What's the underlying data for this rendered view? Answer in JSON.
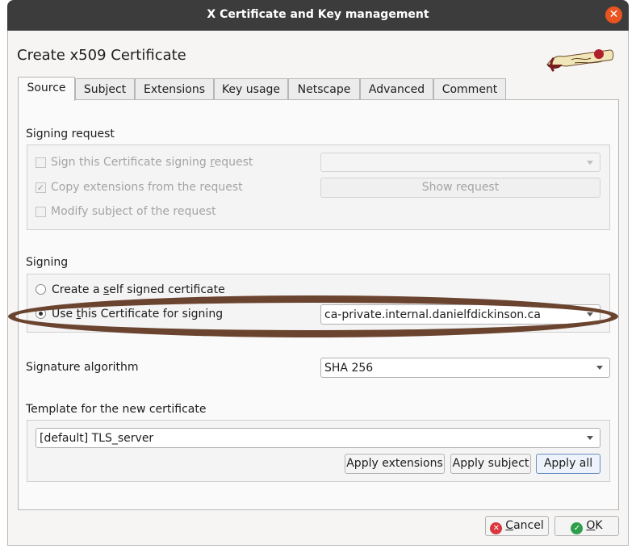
{
  "window": {
    "title": "X Certificate and Key management",
    "close_glyph": "✕",
    "accent_color": "#e95420"
  },
  "dialog": {
    "heading": "Create x509 Certificate"
  },
  "tabs": [
    {
      "label": "Source"
    },
    {
      "label": "Subject"
    },
    {
      "label": "Extensions"
    },
    {
      "label": "Key usage"
    },
    {
      "label": "Netscape"
    },
    {
      "label": "Advanced"
    },
    {
      "label": "Comment"
    }
  ],
  "signing_request": {
    "section_label": "Signing request",
    "sign_csr": {
      "pre": "Sign this Certificate signing ",
      "accel": "r",
      "post": "equest",
      "checked": false
    },
    "copy_extensions": {
      "label": "Copy extensions from the request",
      "checked": true,
      "check_glyph": "✓"
    },
    "modify_subject": {
      "label": "Modify subject of the request",
      "checked": false
    },
    "request_select_value": "",
    "show_request_label": "Show request"
  },
  "signing": {
    "section_label": "Signing",
    "self_signed": {
      "pre": "Create a ",
      "accel": "s",
      "post": "elf signed certificate",
      "selected": false
    },
    "use_cert": {
      "pre": "Use ",
      "accel": "t",
      "post": "his Certificate for signing",
      "selected": true
    },
    "signing_cert_value": "ca-private.internal.danielfdickinson.ca"
  },
  "signature": {
    "label": "Signature algorithm",
    "value": "SHA 256"
  },
  "template": {
    "label": "Template for the new certificate",
    "value": "[default] TLS_server",
    "apply_extensions": "Apply extensions",
    "apply_subject": "Apply subject",
    "apply_all": "Apply all"
  },
  "footer": {
    "cancel": {
      "accel": "C",
      "rest": "ancel",
      "icon": "cancel-icon",
      "icon_glyph": "✕",
      "color": "#d9363e"
    },
    "ok": {
      "accel": "O",
      "rest": "K",
      "icon": "ok-icon",
      "icon_glyph": "✓",
      "color": "#2e9e4a"
    }
  },
  "annotation": {
    "color": "#6b4430"
  }
}
